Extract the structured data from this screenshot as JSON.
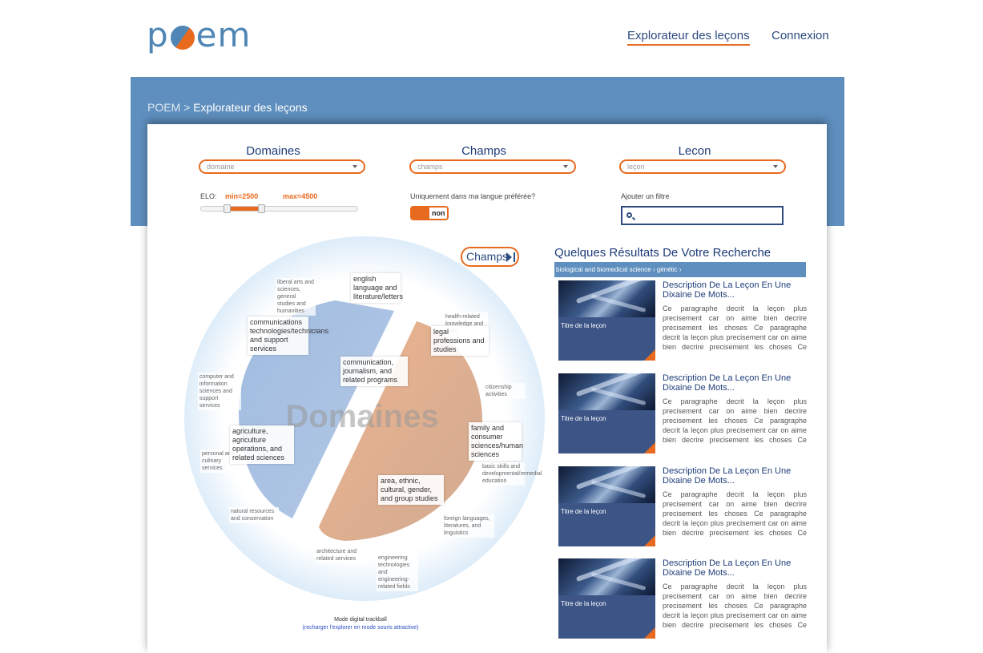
{
  "header": {
    "logo": "poem",
    "nav": [
      "Explorateur des leçons",
      "Connexion"
    ]
  },
  "breadcrumb": {
    "root": "POEM",
    "sep": ">",
    "current": "Explorateur des leçons"
  },
  "filters": {
    "domaines": {
      "title": "Domaines",
      "value": "domaine"
    },
    "champs": {
      "title": "Champs",
      "value": "champs"
    },
    "lecon": {
      "title": "Lecon",
      "value": "leçon"
    },
    "elo": {
      "label": "ELO:",
      "min": "min=2500",
      "max": "max=4500"
    },
    "langue": {
      "label": "Uniquement dans ma langue préférée?",
      "toggle": "non"
    },
    "ajouter": {
      "label": "Ajouter un filtre"
    }
  },
  "viz": {
    "center": "Domaines",
    "champs_button": "Champs",
    "labels_big": [
      "communications technologies/technicians and support services",
      "communication, journalism, and related programs",
      "agriculture, agriculture operations, and related sciences",
      "area, ethnic, cultural, gender, and group studies",
      "family and consumer sciences/human sciences",
      "legal professions and studies",
      "english language and literature/letters"
    ],
    "labels_small": [
      "liberal arts and sciences, general studies and humanities",
      "health-related knowledge and skills",
      "computer and information sciences and support services",
      "citizenship activities",
      "personal and culinary services",
      "basic skills and developmental/remedial education",
      "natural resources and conservation",
      "foreign languages, literatures, and linguistics",
      "architecture and related services",
      "engineering technologies and engineering-related fields"
    ],
    "mode": "Mode digital trackball",
    "reload": "(recharger l'explorer en mode souris attractive)"
  },
  "results": {
    "title": "Quelques Résultats De Votre Recherche",
    "breadcrumb": "biological and biomedical science › génétic ›",
    "items": [
      {
        "title": "Description De La Leçon En Une Dixaine De Mots...",
        "thumb": "Titre de la leçon",
        "desc": "Ce paragraphe decrit la leçon plus precisement car on aime bien decrire precisement les choses Ce paragraphe decrit la leçon plus precisement car on aime bien decrire precisement les choses Ce paragraphe decrit la leçon plus"
      },
      {
        "title": "Description De La Leçon En Une Dixaine De Mots...",
        "thumb": "Titre de la leçon",
        "desc": "Ce paragraphe decrit la leçon plus precisement car on aime bien decrire precisement les choses Ce paragraphe decrit la leçon plus precisement car on aime bien decrire precisement les choses Ce paragraphe decrit la leçon plus"
      },
      {
        "title": "Description De La Leçon En Une Dixaine De Mots...",
        "thumb": "Titre de la leçon",
        "desc": "Ce paragraphe decrit la leçon plus precisement car on aime bien decrire precisement les choses Ce paragraphe decrit la leçon plus precisement car on aime bien decrire precisement les choses Ce paragraphe decrit la leçon plus"
      },
      {
        "title": "Description De La Leçon En Une Dixaine De Mots...",
        "thumb": "Titre de la leçon",
        "desc": "Ce paragraphe decrit la leçon plus precisement car on aime bien decrire precisement les choses Ce paragraphe decrit la leçon plus precisement car on aime bien decrire precisement les choses Ce paragraphe decrit la leçon plus"
      }
    ]
  }
}
